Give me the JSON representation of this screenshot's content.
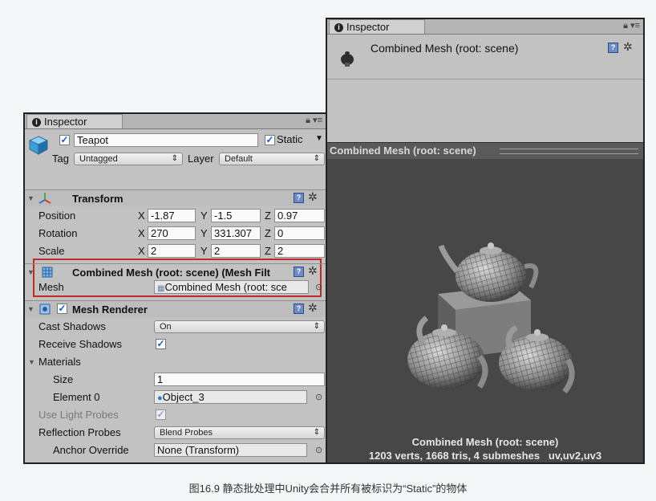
{
  "left_inspector": {
    "tab_title": "Inspector",
    "object": {
      "name": "Teapot",
      "static_label": "Static",
      "tag_label": "Tag",
      "tag_value": "Untagged",
      "layer_label": "Layer",
      "layer_value": "Default"
    },
    "transform": {
      "title": "Transform",
      "rows": [
        {
          "label": "Position",
          "x": "-1.87",
          "y": "-1.5",
          "z": "0.97"
        },
        {
          "label": "Rotation",
          "x": "270",
          "y": "331.307",
          "z": "0"
        },
        {
          "label": "Scale",
          "x": "2",
          "y": "2",
          "z": "2"
        }
      ],
      "axis_x": "X",
      "axis_y": "Y",
      "axis_z": "Z"
    },
    "mesh_filter": {
      "title": "Combined Mesh (root: scene) (Mesh Filt",
      "mesh_label": "Mesh",
      "mesh_value": "Combined Mesh (root: sce"
    },
    "mesh_renderer": {
      "title": "Mesh Renderer",
      "cast_shadows_label": "Cast Shadows",
      "cast_shadows_value": "On",
      "receive_shadows_label": "Receive Shadows",
      "materials_label": "Materials",
      "size_label": "Size",
      "size_value": "1",
      "element0_label": "Element 0",
      "element0_value": "Object_3",
      "light_probes_label": "Use Light Probes",
      "reflection_probes_label": "Reflection Probes",
      "reflection_probes_value": "Blend Probes",
      "anchor_override_label": "Anchor Override",
      "anchor_override_value": "None (Transform)"
    }
  },
  "right_inspector": {
    "tab_title": "Inspector",
    "header_title": "Combined Mesh (root: scene)",
    "preview_title": "Combined Mesh (root: scene)",
    "preview_caption_name": "Combined Mesh (root: scene)",
    "preview_caption_stats": "1203 verts, 1668 tris, 4 submeshes   uv,uv2,uv3"
  },
  "figure_caption": "图16.9 静态批处理中Unity会合并所有被标识为“Static”的物体",
  "colors": {
    "panel_bg": "#c2c2c2",
    "viewport_bg": "#474747",
    "highlight_border": "#c0282d",
    "check_blue": "#1a57c7"
  },
  "icons": [
    "cube-icon",
    "lock-icon",
    "menu-icon",
    "transform-axes-icon",
    "mesh-filter-icon",
    "mesh-renderer-icon",
    "help-icon",
    "gear-icon",
    "object-picker-icon"
  ]
}
